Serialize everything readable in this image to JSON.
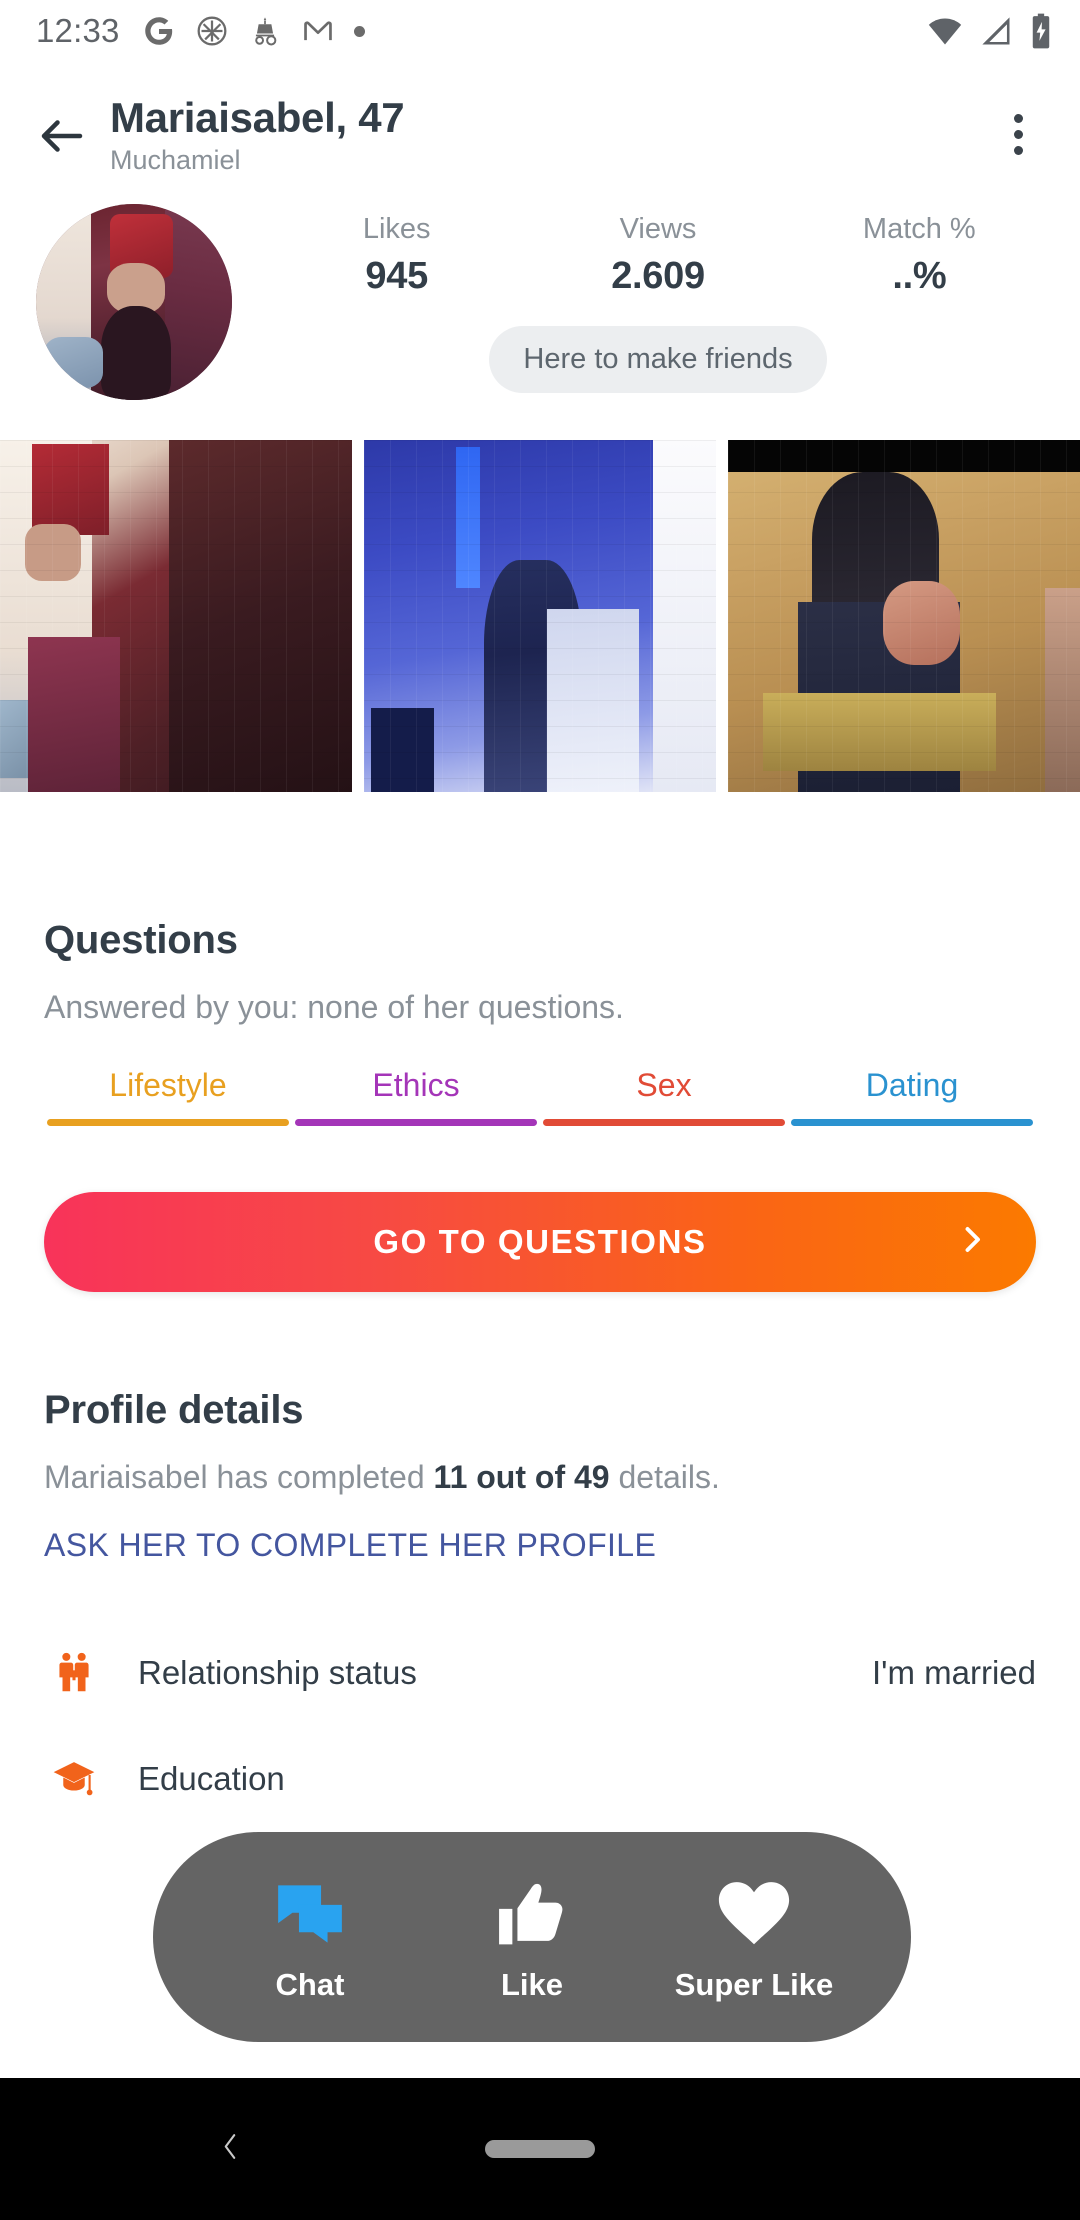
{
  "status_bar": {
    "time": "12:33",
    "left_icons": [
      "google-g-icon",
      "badge-circle-icon",
      "carriage-icon",
      "gmail-m-icon",
      "notification-dot-icon"
    ],
    "right_icons": [
      "wifi-icon",
      "cellular-signal-icon",
      "battery-charging-icon"
    ]
  },
  "app_bar": {
    "back_icon": "arrow-left-icon",
    "title": "Mariaisabel, 47",
    "subtitle": "Muchamiel",
    "overflow_icon": "more-vertical-icon"
  },
  "summary": {
    "avatar_alt": "profile-photo",
    "stats": [
      {
        "label": "Likes",
        "value": "945"
      },
      {
        "label": "Views",
        "value": "2.609"
      },
      {
        "label": "Match %",
        "value": "..%"
      }
    ],
    "intent_chip": "Here to make friends"
  },
  "photos": [
    {
      "name": "photo-1"
    },
    {
      "name": "photo-2"
    },
    {
      "name": "photo-3"
    }
  ],
  "questions": {
    "title": "Questions",
    "answered_text": "Answered by you: none of her questions.",
    "tabs": [
      {
        "label": "Lifestyle",
        "color": "#E8A020"
      },
      {
        "label": "Ethics",
        "color": "#A435B8"
      },
      {
        "label": "Sex",
        "color": "#E14B36"
      },
      {
        "label": "Dating",
        "color": "#2A92D0"
      }
    ],
    "cta_label": "GO TO QUESTIONS",
    "cta_icon": "chevron-right-icon",
    "cta_gradient_from": "#F8335A",
    "cta_gradient_to": "#FB7A00"
  },
  "profile_details": {
    "title": "Profile details",
    "completion_prefix": "Mariaisabel has completed ",
    "completion_bold": "11 out of 49",
    "completion_suffix": " details.",
    "ask_link": "ASK HER TO COMPLETE HER PROFILE",
    "link_color": "#44569F",
    "rows": [
      {
        "icon": "couple-icon",
        "label": "Relationship status",
        "value": "I'm married"
      },
      {
        "icon": "graduation-cap-icon",
        "label": "Education",
        "value": ""
      }
    ]
  },
  "action_bar": {
    "items": [
      {
        "icon": "chat-bubbles-icon",
        "label": "Chat",
        "color": "#29A3F0"
      },
      {
        "icon": "thumbs-up-icon",
        "label": "Like",
        "color": "#FFFFFF"
      },
      {
        "icon": "heart-icon",
        "label": "Super Like",
        "color": "#FFFFFF"
      }
    ]
  },
  "nav_bar": {
    "back_icon": "nav-back-chevron-icon",
    "home_pill": "nav-home-pill"
  }
}
